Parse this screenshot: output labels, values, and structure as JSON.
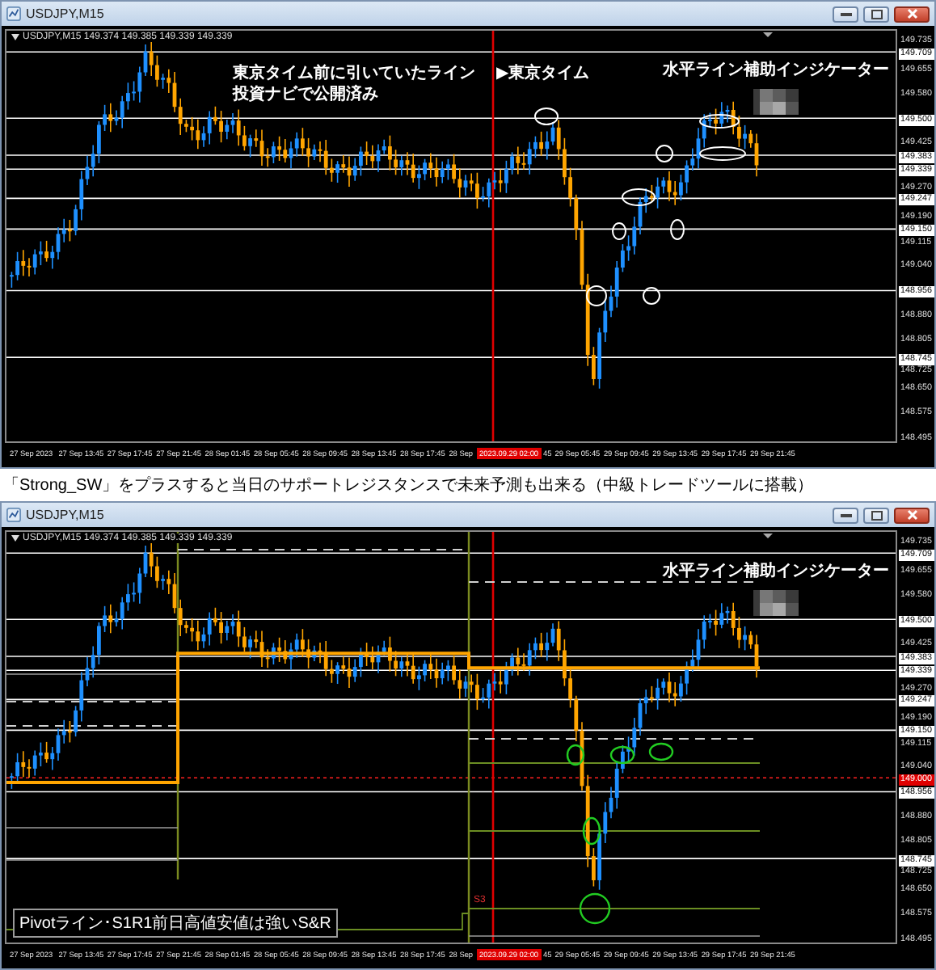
{
  "windows": [
    {
      "title": "USDJPY,M15",
      "symbol_info": "USDJPY,M15  149.374 149.385 149.339 149.339",
      "kind": "ellipses",
      "redacted": true,
      "annotations": [
        {
          "text": "東京タイム前に引いていたライン",
          "kind": "note"
        },
        {
          "text": "投資ナビで公開済み",
          "kind": "note"
        },
        {
          "text": "▶東京タイム",
          "kind": "session"
        },
        {
          "text": "水平ライン補助インジケーター",
          "kind": "indicator"
        }
      ],
      "price_axis": [
        {
          "text": "149.735",
          "kind": "plain"
        },
        {
          "text": "149.709",
          "kind": "boxed"
        },
        {
          "text": "149.655",
          "kind": "plain"
        },
        {
          "text": "149.580",
          "kind": "plain"
        },
        {
          "text": "149.500",
          "kind": "boxed"
        },
        {
          "text": "149.425",
          "kind": "plain"
        },
        {
          "text": "149.383",
          "kind": "boxed"
        },
        {
          "text": "149.339",
          "kind": "boxed"
        },
        {
          "text": "149.270",
          "kind": "plain"
        },
        {
          "text": "149.247",
          "kind": "boxed"
        },
        {
          "text": "149.190",
          "kind": "plain"
        },
        {
          "text": "149.150",
          "kind": "boxed"
        },
        {
          "text": "149.115",
          "kind": "plain"
        },
        {
          "text": "149.040",
          "kind": "plain"
        },
        {
          "text": "148.956",
          "kind": "boxed"
        },
        {
          "text": "148.880",
          "kind": "plain"
        },
        {
          "text": "148.805",
          "kind": "plain"
        },
        {
          "text": "148.745",
          "kind": "boxed"
        },
        {
          "text": "148.725",
          "kind": "plain"
        },
        {
          "text": "148.650",
          "kind": "plain"
        },
        {
          "text": "148.575",
          "kind": "plain"
        },
        {
          "text": "148.495",
          "kind": "plain"
        }
      ],
      "time_axis": [
        {
          "text": "27 Sep 2023",
          "kind": "tick"
        },
        {
          "text": "27 Sep 13:45",
          "kind": "tick"
        },
        {
          "text": "27 Sep 17:45",
          "kind": "tick"
        },
        {
          "text": "27 Sep 21:45",
          "kind": "tick"
        },
        {
          "text": "28 Sep 01:45",
          "kind": "tick"
        },
        {
          "text": "28 Sep 05:45",
          "kind": "tick"
        },
        {
          "text": "28 Sep 09:45",
          "kind": "tick"
        },
        {
          "text": "28 Sep 13:45",
          "kind": "tick"
        },
        {
          "text": "28 Sep 17:45",
          "kind": "tick"
        },
        {
          "text": "28 Sep",
          "kind": "cut"
        },
        {
          "text": "2023.09.29 02:00",
          "kind": "cursor"
        },
        {
          "text": "45",
          "kind": "cut"
        },
        {
          "text": "29 Sep 05:45",
          "kind": "tick"
        },
        {
          "text": "29 Sep 09:45",
          "kind": "tick"
        },
        {
          "text": "29 Sep 13:45",
          "kind": "tick"
        },
        {
          "text": "29 Sep 17:45",
          "kind": "tick"
        },
        {
          "text": "29 Sep 21:45",
          "kind": "tick"
        }
      ]
    },
    {
      "title": "USDJPY,M15",
      "symbol_info": "USDJPY,M15  149.374 149.385 149.339 149.339",
      "kind": "pivots",
      "redacted": true,
      "annotations": [
        {
          "text": "水平ライン補助インジケーター",
          "kind": "indicator"
        }
      ],
      "level_tags": [
        "S3"
      ],
      "legend": "Pivotライン･S1R1前日高値安値は強いS&R",
      "price_axis": [
        {
          "text": "149.735",
          "kind": "plain"
        },
        {
          "text": "149.709",
          "kind": "boxed"
        },
        {
          "text": "149.655",
          "kind": "plain"
        },
        {
          "text": "149.580",
          "kind": "plain"
        },
        {
          "text": "149.500",
          "kind": "boxed"
        },
        {
          "text": "149.425",
          "kind": "plain"
        },
        {
          "text": "149.383",
          "kind": "boxed"
        },
        {
          "text": "149.339",
          "kind": "boxed"
        },
        {
          "text": "149.270",
          "kind": "plain"
        },
        {
          "text": "149.247",
          "kind": "boxed"
        },
        {
          "text": "149.190",
          "kind": "plain"
        },
        {
          "text": "149.150",
          "kind": "boxed"
        },
        {
          "text": "149.115",
          "kind": "plain"
        },
        {
          "text": "149.040",
          "kind": "plain"
        },
        {
          "text": "149.000",
          "kind": "alert"
        },
        {
          "text": "148.956",
          "kind": "boxed"
        },
        {
          "text": "148.880",
          "kind": "plain"
        },
        {
          "text": "148.805",
          "kind": "plain"
        },
        {
          "text": "148.745",
          "kind": "boxed"
        },
        {
          "text": "148.725",
          "kind": "plain"
        },
        {
          "text": "148.650",
          "kind": "plain"
        },
        {
          "text": "148.575",
          "kind": "plain"
        },
        {
          "text": "148.495",
          "kind": "plain"
        }
      ],
      "time_axis": [
        {
          "text": "27 Sep 2023",
          "kind": "tick"
        },
        {
          "text": "27 Sep 13:45",
          "kind": "tick"
        },
        {
          "text": "27 Sep 17:45",
          "kind": "tick"
        },
        {
          "text": "27 Sep 21:45",
          "kind": "tick"
        },
        {
          "text": "28 Sep 01:45",
          "kind": "tick"
        },
        {
          "text": "28 Sep 05:45",
          "kind": "tick"
        },
        {
          "text": "28 Sep 09:45",
          "kind": "tick"
        },
        {
          "text": "28 Sep 13:45",
          "kind": "tick"
        },
        {
          "text": "28 Sep 17:45",
          "kind": "tick"
        },
        {
          "text": "28 Sep",
          "kind": "cut"
        },
        {
          "text": "2023.09.29 02:00",
          "kind": "cursor"
        },
        {
          "text": "45",
          "kind": "cut"
        },
        {
          "text": "29 Sep 05:45",
          "kind": "tick"
        },
        {
          "text": "29 Sep 09:45",
          "kind": "tick"
        },
        {
          "text": "29 Sep 13:45",
          "kind": "tick"
        },
        {
          "text": "29 Sep 17:45",
          "kind": "tick"
        },
        {
          "text": "29 Sep 21:45",
          "kind": "tick"
        }
      ]
    }
  ],
  "caption": "「Strong_SW」をプラスすると当日のサポートレジスタンスで未来予測も出来る（中級トレードツールに搭載）"
}
